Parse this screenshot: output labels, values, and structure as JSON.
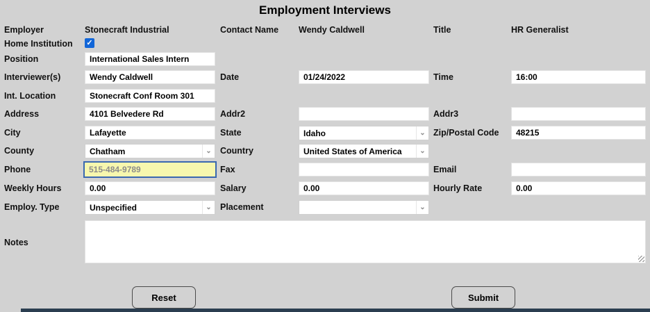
{
  "title": "Employment Interviews",
  "icons": {
    "check": "✓",
    "chevron_down": "⌄"
  },
  "header": {
    "employer_label": "Employer",
    "employer_value": "Stonecraft Industrial",
    "contact_label": "Contact Name",
    "contact_value": "Wendy Caldwell",
    "title_label": "Title",
    "title_value": "HR Generalist",
    "home_institution_label": "Home Institution",
    "home_institution_checked": "true"
  },
  "fields": {
    "position": {
      "label": "Position",
      "value": "International Sales Intern"
    },
    "interviewers": {
      "label": "Interviewer(s)",
      "value": "Wendy Caldwell"
    },
    "date": {
      "label": "Date",
      "value": "01/24/2022"
    },
    "time": {
      "label": "Time",
      "value": "16:00"
    },
    "int_location": {
      "label": "Int. Location",
      "value": "Stonecraft Conf Room 301"
    },
    "address": {
      "label": "Address",
      "value": "4101 Belvedere Rd"
    },
    "addr2": {
      "label": "Addr2",
      "value": ""
    },
    "addr3": {
      "label": "Addr3",
      "value": ""
    },
    "city": {
      "label": "City",
      "value": "Lafayette"
    },
    "state": {
      "label": "State",
      "value": "Idaho"
    },
    "zip": {
      "label": "Zip/Postal Code",
      "value": "48215"
    },
    "county": {
      "label": "County",
      "value": "Chatham"
    },
    "country": {
      "label": "Country",
      "value": "United States of America"
    },
    "phone": {
      "label": "Phone",
      "value": "515-484-9789"
    },
    "fax": {
      "label": "Fax",
      "value": ""
    },
    "email": {
      "label": "Email",
      "value": ""
    },
    "weekly_hours": {
      "label": "Weekly Hours",
      "value": "0.00"
    },
    "salary": {
      "label": "Salary",
      "value": "0.00"
    },
    "hourly_rate": {
      "label": "Hourly Rate",
      "value": "0.00"
    },
    "employ_type": {
      "label": "Employ. Type",
      "value": "Unspecified"
    },
    "placement": {
      "label": "Placement",
      "value": ""
    },
    "notes": {
      "label": "Notes",
      "value": ""
    }
  },
  "buttons": {
    "reset": "Reset",
    "submit": "Submit"
  },
  "colors": {
    "background": "#d2d2d2",
    "highlight_field_bg": "#f7f7ae",
    "highlight_field_border": "#3a68b0",
    "checkbox_blue": "#1266d8",
    "bottom_bar": "#2b3e50"
  }
}
